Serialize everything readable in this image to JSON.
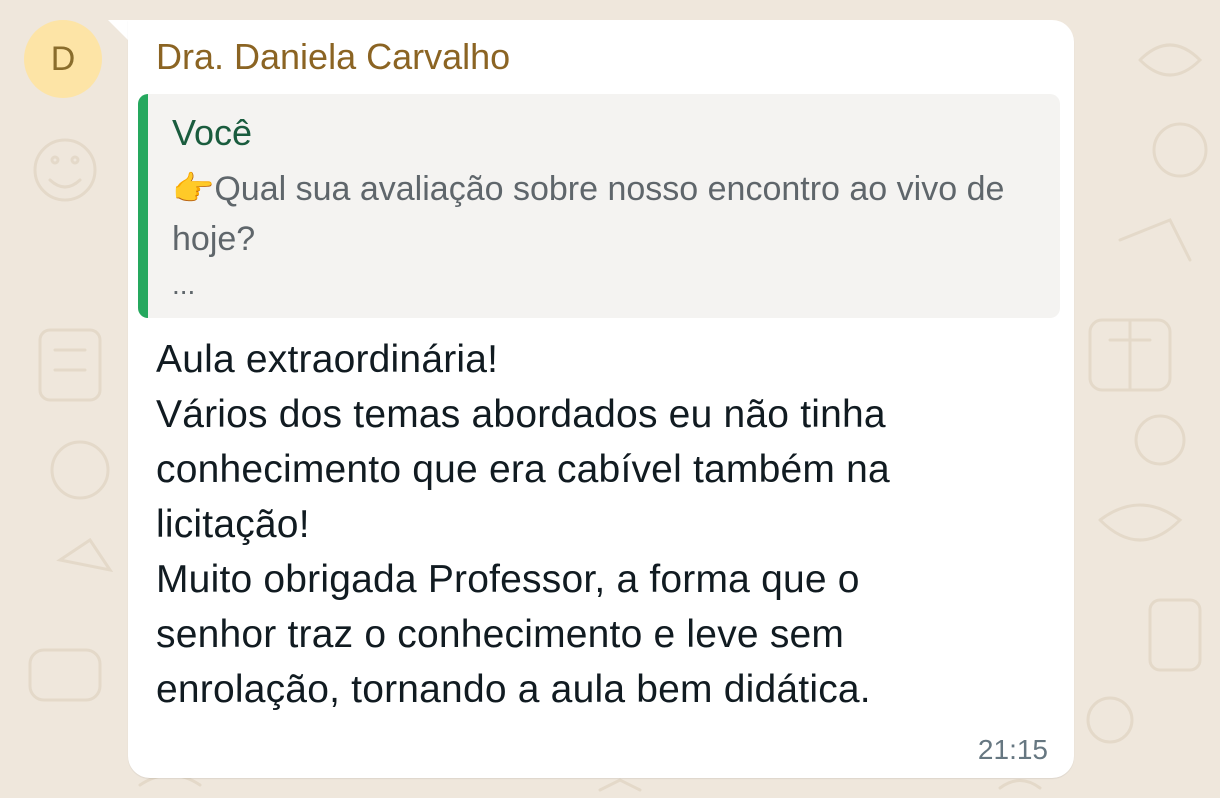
{
  "chat": {
    "avatar_letter": "D",
    "sender_name": "Dra. Daniela Carvalho",
    "quoted": {
      "author": "Você",
      "text": "👉Qual sua avaliação sobre nosso encontro ao vivo de hoje?",
      "ellipsis": "..."
    },
    "message_lines": [
      "Aula extraordinária!",
      "Vários dos temas abordados eu não tinha",
      "conhecimento que era cabível também na",
      "licitação!",
      "Muito obrigada Professor, a forma que o",
      "senhor traz o conhecimento e leve sem",
      "enrolação, tornando a aula bem didática."
    ],
    "timestamp": "21:15"
  },
  "colors": {
    "background": "#efe7dc",
    "bubble": "#ffffff",
    "sender_name": "#8b6423",
    "quote_bar": "#25a85e",
    "quote_author": "#1a5c3e",
    "avatar_bg": "#fde4a6"
  }
}
